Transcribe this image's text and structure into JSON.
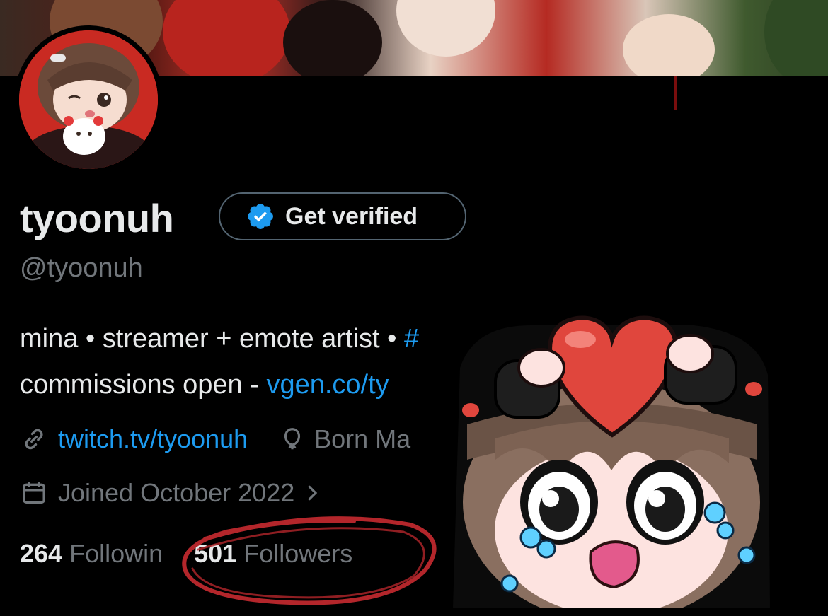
{
  "profile": {
    "display_name": "tyoonuh",
    "handle": "@tyoonuh",
    "verify_button_label": "Get verified",
    "bio_line1_text": "mina • streamer + emote artist • ",
    "bio_line1_hashtag": "#",
    "bio_line2_text": "commissions open - ",
    "bio_line2_link": "vgen.co/ty",
    "website": "twitch.tv/tyoonuh",
    "birthday": "Born Ma",
    "joined": "Joined October 2022",
    "following_count": "264",
    "following_label": "Followin",
    "followers_count": "501",
    "followers_label": "Followers"
  },
  "colors": {
    "background": "#000000",
    "text": "#e7e9ea",
    "muted": "#71767b",
    "link": "#1d9bf0",
    "verified_badge": "#1d9bf0",
    "annotation_circle": "#b3262b"
  },
  "icons": [
    "verified-badge-icon",
    "link-icon",
    "balloon-icon",
    "calendar-icon",
    "chevron-right-icon"
  ]
}
